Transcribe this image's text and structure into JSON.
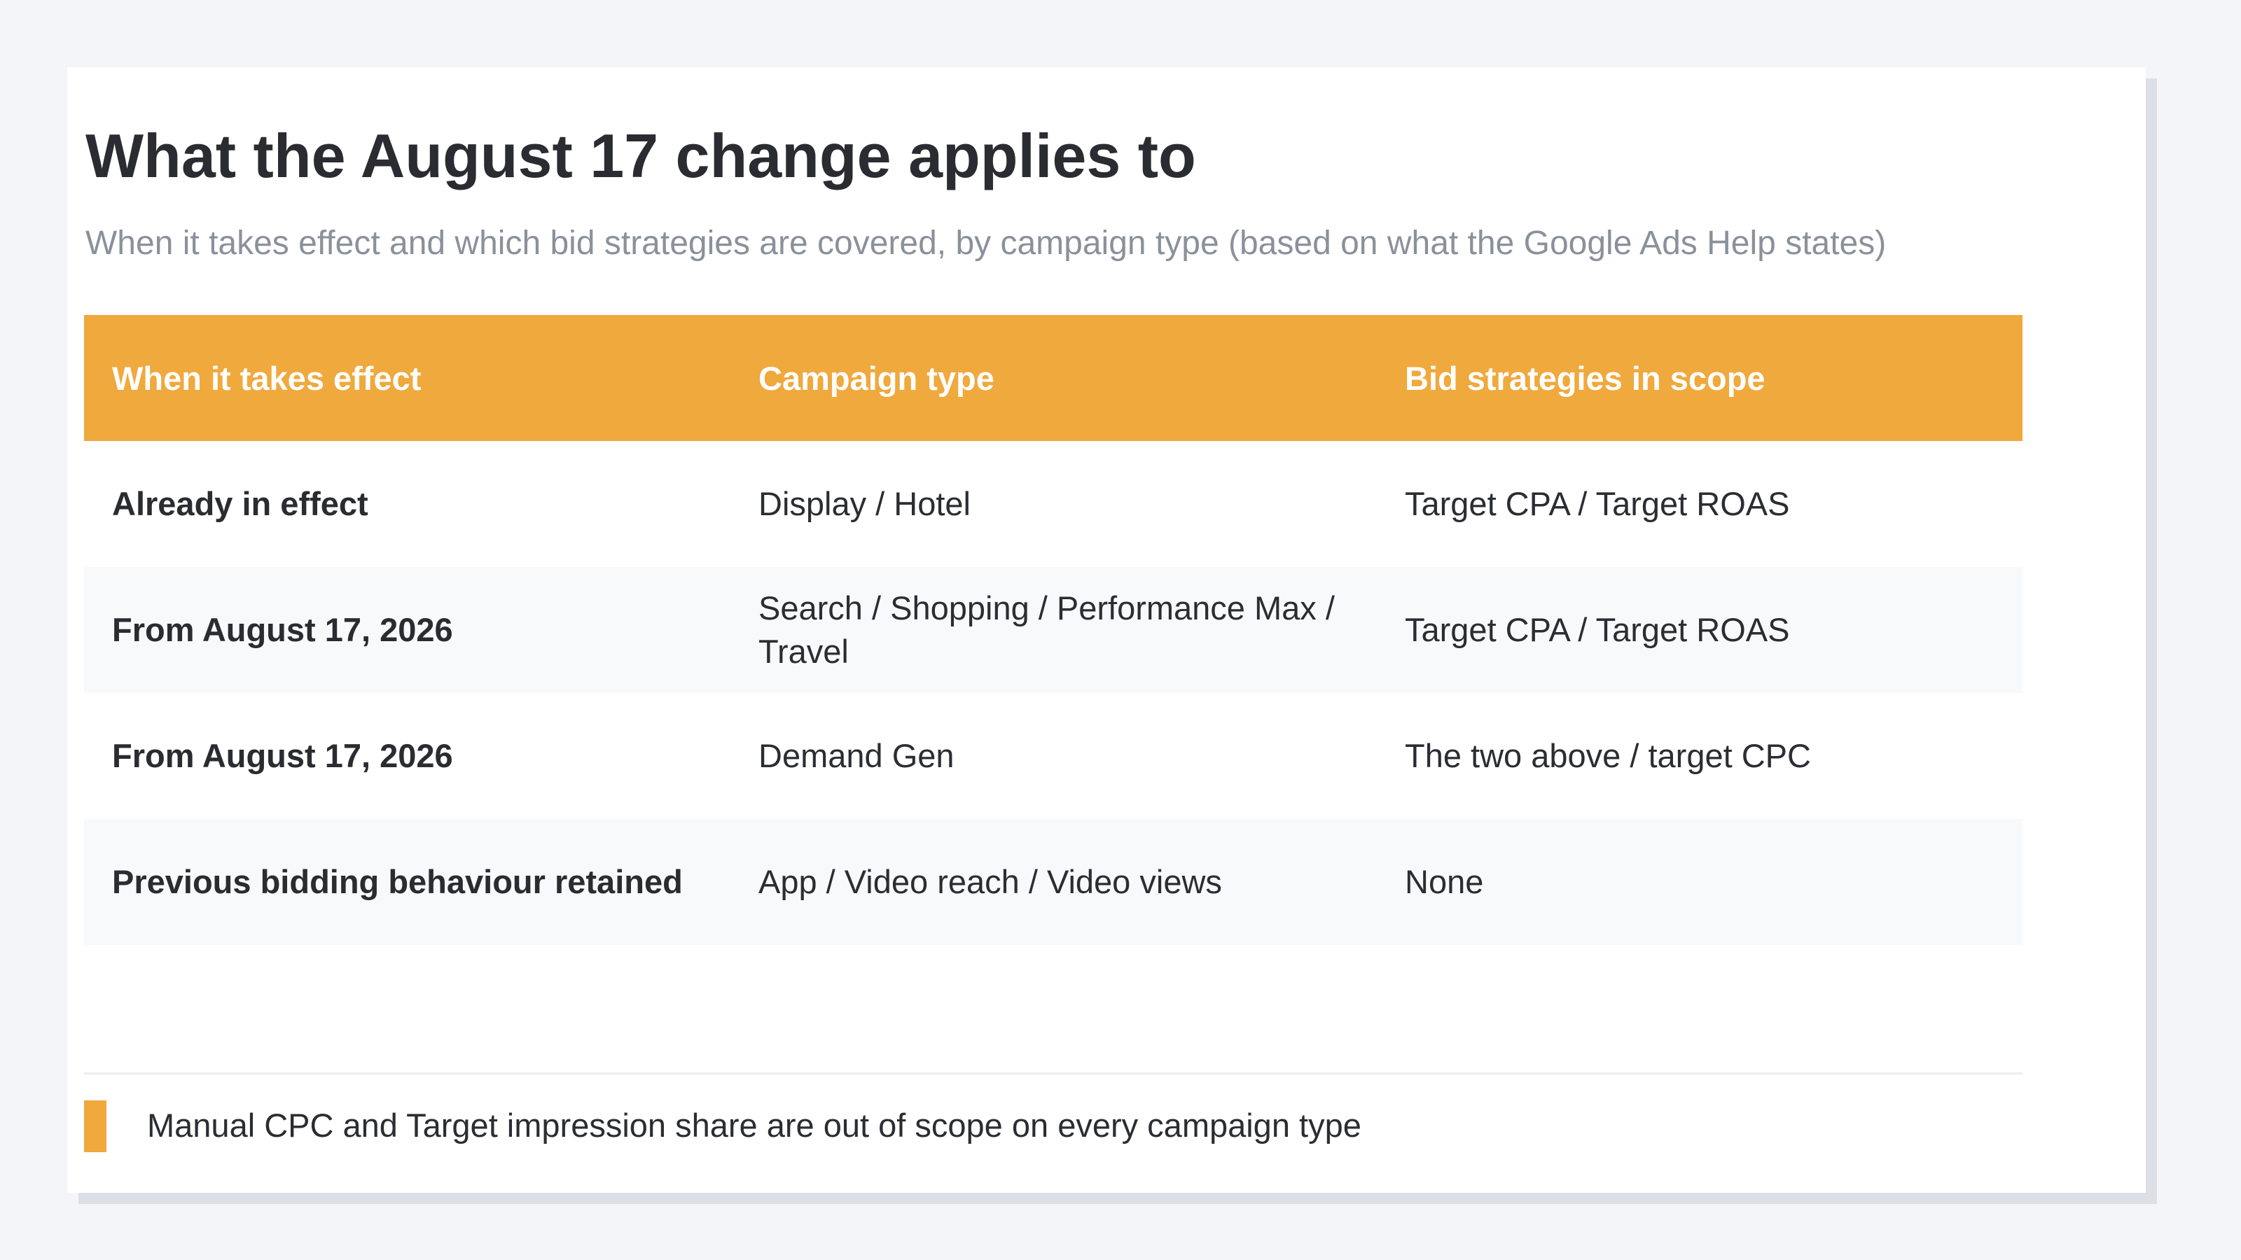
{
  "title": "What the August 17 change applies to",
  "subtitle": "When it takes effect and which bid strategies are covered, by campaign type (based on what the Google Ads Help states)",
  "table": {
    "headers": [
      "When it takes effect",
      "Campaign type",
      "Bid strategies in scope"
    ],
    "rows": [
      [
        "Already in effect",
        "Display / Hotel",
        "Target CPA / Target ROAS"
      ],
      [
        "From August 17, 2026",
        "Search / Shopping / Performance Max / Travel",
        "Target CPA / Target ROAS"
      ],
      [
        "From August 17, 2026",
        "Demand Gen",
        "The two above / target CPC"
      ],
      [
        "Previous bidding behaviour retained",
        "App / Video reach / Video views",
        "None"
      ]
    ]
  },
  "note": "Manual CPC and Target impression share are out of scope on every campaign type",
  "colors": {
    "accent": "#f0a93d",
    "title": "#2a2c31",
    "subtitle": "#8a919b",
    "alt_row": "#f8f9fb"
  }
}
